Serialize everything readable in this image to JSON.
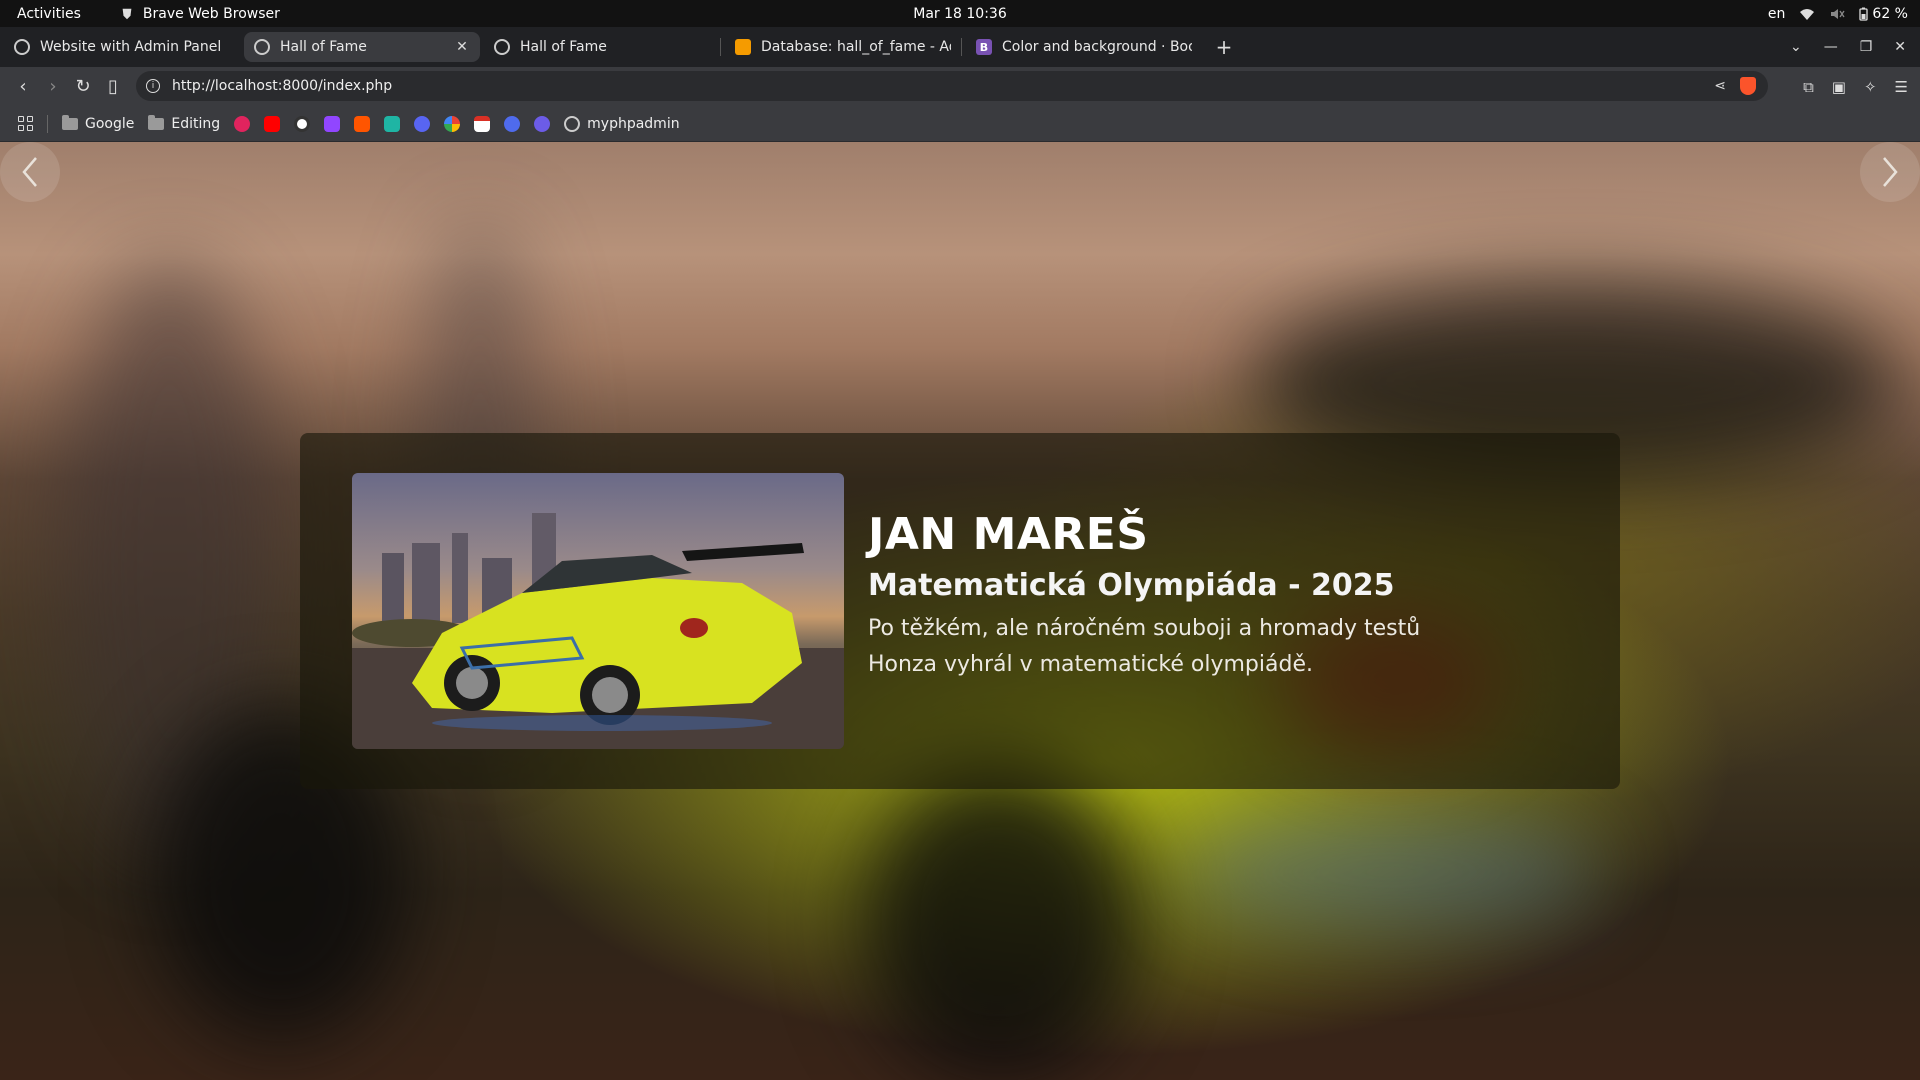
{
  "topbar": {
    "activities": "Activities",
    "app_name": "Brave Web Browser",
    "clock": "Mar 18  10:36",
    "lang": "en",
    "battery": "62 %"
  },
  "tabs": [
    {
      "label": "Website with Admin Panel",
      "active": false,
      "favicon": "globe-icon"
    },
    {
      "label": "Hall of Fame",
      "active": true,
      "favicon": "globe-icon"
    },
    {
      "label": "Hall of Fame",
      "active": false,
      "favicon": "globe-icon"
    },
    {
      "label": "Database: hall_of_fame - Ad",
      "active": false,
      "favicon": "phpmyadmin-icon"
    },
    {
      "label": "Color and background · Boo",
      "active": false,
      "favicon": "bootstrap-icon"
    }
  ],
  "toolbar": {
    "url": "http://localhost:8000/index.php"
  },
  "bookmarks": {
    "google": "Google",
    "editing": "Editing",
    "myphpadmin": "myphpadmin"
  },
  "colors": {
    "brave_orange": "#fb542b",
    "accent_yellow": "#c8d21e"
  },
  "hero": {
    "name": "JAN MAREŠ",
    "event": "Matematická Olympiáda - 2025",
    "description": "Po těžkém, ale náročném souboji a hromady testů Honza vyhrál v matematické olympiádě."
  }
}
